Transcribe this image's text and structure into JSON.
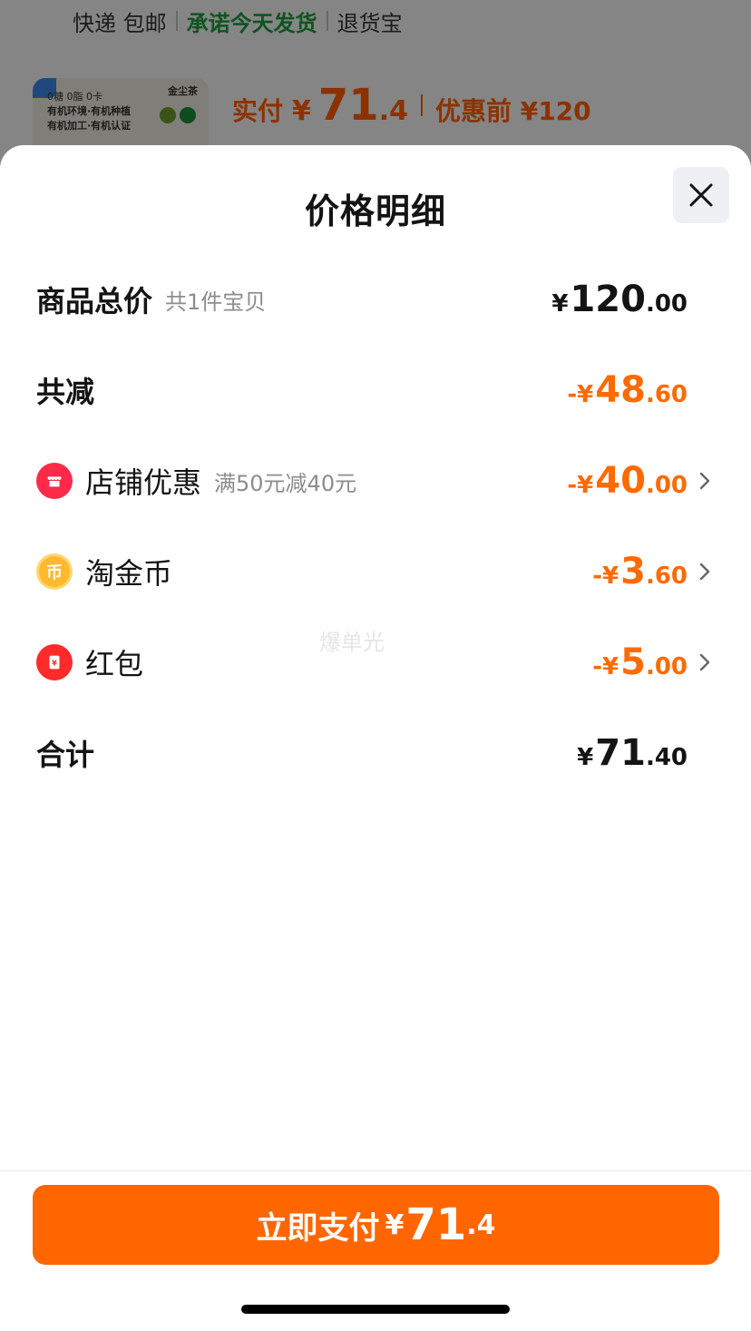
{
  "background": {
    "shipping": {
      "item1": "快递 包邮",
      "item2": "承诺今天发货",
      "item3": "退货宝"
    },
    "product": {
      "brand": "金尘茶",
      "line1": "0糖 0脂 0卡",
      "line2": "有机环境·有机种植",
      "line3": "有机加工·有机认证"
    },
    "price": {
      "label": "实付",
      "currency": "¥",
      "integer": "71",
      "decimal": ".4",
      "before_label": "优惠前 ¥120"
    }
  },
  "sheet": {
    "title": "价格明细",
    "close_icon": "close-icon",
    "rows": [
      {
        "label": "商品总价",
        "sub": "共1件宝贝",
        "currency": "¥",
        "integer": "120",
        "decimal": ".00",
        "color": "#141414"
      },
      {
        "label": "共减",
        "currency": "-¥",
        "integer": "48",
        "decimal": ".60",
        "color": "#ff6a00"
      },
      {
        "label": "店铺优惠",
        "sub": "满50元减40元",
        "currency": "-¥",
        "integer": "40",
        "decimal": ".00",
        "icon": "shop-coupon-icon",
        "color": "#ff6a00"
      },
      {
        "label": "淘金币",
        "currency": "-¥",
        "integer": "3",
        "decimal": ".60",
        "icon": "gold-coin-icon",
        "icon_text": "币",
        "color": "#ff6a00"
      },
      {
        "label": "红包",
        "currency": "-¥",
        "integer": "5",
        "decimal": ".00",
        "icon": "red-envelope-icon",
        "color": "#ff6a00"
      },
      {
        "label": "合计",
        "currency": "¥",
        "integer": "71",
        "decimal": ".40",
        "color": "#141414"
      }
    ],
    "watermark": "爆单光",
    "pay_button": {
      "label": "立即支付",
      "currency": "¥",
      "integer": "71",
      "decimal": ".4",
      "color": "#ff6600"
    }
  }
}
